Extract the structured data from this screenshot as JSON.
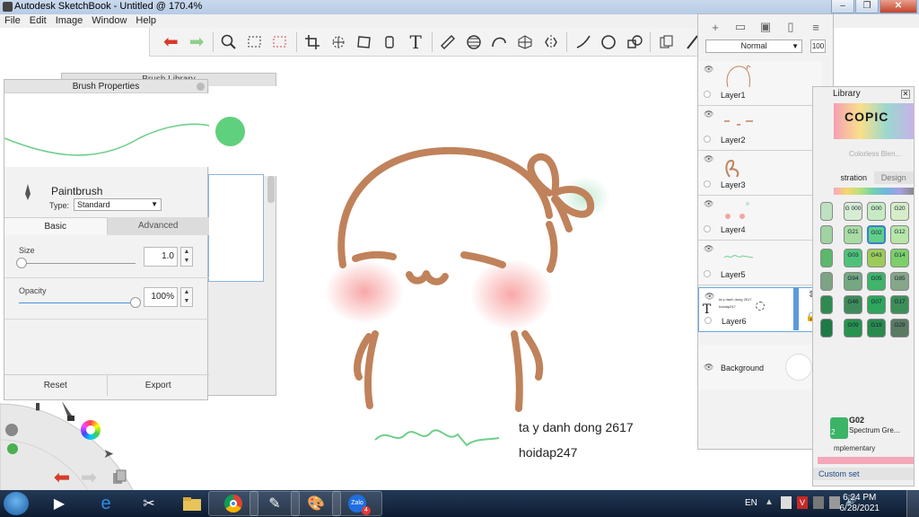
{
  "titlebar": {
    "title": "Autodesk SketchBook - Untitled @ 170.4%",
    "minimize": "–",
    "restore": "❐",
    "close": "✕"
  },
  "menu": {
    "file": "File",
    "edit": "Edit",
    "image": "Image",
    "window": "Window",
    "help": "Help"
  },
  "toolbar_icons": [
    "undo-icon",
    "redo-icon",
    "zoom-icon",
    "select-rect-icon",
    "select-lasso-icon",
    "crop-icon",
    "transform-icon",
    "distort-icon",
    "fill-icon",
    "text-icon",
    "ruler-icon",
    "ellipse-guide-icon",
    "curve-icon",
    "perspective-icon",
    "symmetry-icon",
    "line-icon",
    "circle-icon",
    "shape-icon",
    "copy-icon",
    "brush-icon"
  ],
  "brush_library": {
    "title": "Brush Library"
  },
  "brush_properties": {
    "title": "Brush Properties",
    "name": "Paintbrush",
    "type_label": "Type:",
    "type_value": "Standard",
    "tab_basic": "Basic",
    "tab_advanced": "Advanced",
    "size_label": "Size",
    "size_value": "1.0",
    "size_level": 0.02,
    "opacity_label": "Opacity",
    "opacity_value": "100%",
    "opacity_level": 1.0,
    "reset": "Reset",
    "export": "Export",
    "stroke_color": "#6fcf8a",
    "dot_color": "#5fd07e"
  },
  "canvas": {
    "line1": "ta y danh dong 2617",
    "line2": "hoidap247",
    "stroke_color": "#c0825a",
    "blush_color": "#f8a3a3",
    "signature_color": "#6fcf8a"
  },
  "layers": {
    "blend_mode": "Normal",
    "opacity": "100",
    "items": [
      {
        "name": "Layer1"
      },
      {
        "name": "Layer2"
      },
      {
        "name": "Layer3"
      },
      {
        "name": "Layer4"
      },
      {
        "name": "Layer5"
      },
      {
        "name": "Layer6",
        "thumb_text_1": "ta y danh dong 2617",
        "thumb_text_2": "hoidap247"
      }
    ],
    "background": "Background"
  },
  "copic": {
    "title": "Library",
    "logo": "COPIC",
    "colorless": "Colorless Blen...",
    "tab_illustration": "stration",
    "tab_design": "Design",
    "swatches": [
      [
        "",
        "G\n000",
        "G00",
        "G20"
      ],
      [
        "",
        "G21",
        "G02",
        "G12"
      ],
      [
        "",
        "G03",
        "G43",
        "G14"
      ],
      [
        "",
        "G94",
        "G05",
        "G85"
      ],
      [
        "",
        "G46",
        "G07",
        "G17"
      ],
      [
        "",
        "G09",
        "G19",
        "G29"
      ]
    ],
    "current_code": "G02",
    "current_name": "Spectrum Gre...",
    "current_num": "2",
    "complementary": "mplementary",
    "custom_set": "Custom set"
  },
  "taskbar": {
    "lang": "EN",
    "time": "6:24 PM",
    "date": "6/28/2021",
    "zalo_badge": "4"
  }
}
